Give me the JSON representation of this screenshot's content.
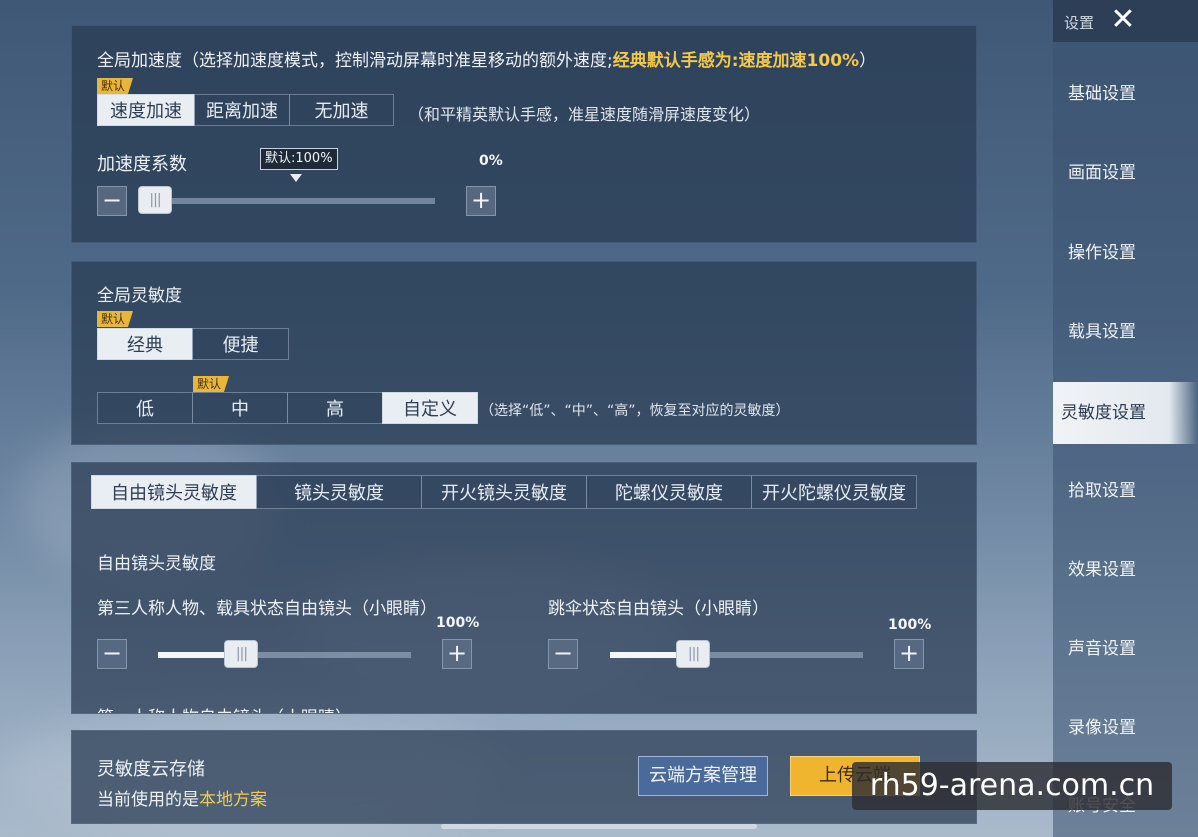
{
  "accel": {
    "title": "全局加速度（选择加速度模式，控制滑动屏幕时准星移动的额外速度;",
    "title_highlight": "经典默认手感为:速度加速100%",
    "title_end": "）",
    "default_badge": "默认",
    "modes": [
      "速度加速",
      "距离加速",
      "无加速"
    ],
    "mode_hint": "（和平精英默认手感，准星速度随滑屏速度变化）",
    "coef_label": "加速度系数",
    "tooltip": "默认:100%",
    "coef_value": "0%",
    "coef_level": 0.0
  },
  "global_sens": {
    "title": "全局灵敏度",
    "default_badge": "默认",
    "styles": [
      "经典",
      "便捷"
    ],
    "level_badge": "默认",
    "levels": [
      "低",
      "中",
      "高",
      "自定义"
    ],
    "level_hint": "（选择“低”、“中”、“高”，恢复至对应的灵敏度）"
  },
  "sens_tabs": [
    "自由镜头灵敏度",
    "镜头灵敏度",
    "开火镜头灵敏度",
    "陀螺仪灵敏度",
    "开火陀螺仪灵敏度"
  ],
  "free_cam": {
    "section_title": "自由镜头灵敏度",
    "slider1_label": "第三人称人物、载具状态自由镜头（小眼睛）",
    "slider1_value": "100%",
    "slider1_level": 0.33,
    "slider2_label": "跳伞状态自由镜头（小眼睛）",
    "slider2_value": "100%",
    "slider2_level": 0.33,
    "next_label_partial": "第一人称人物自由镜头（小眼睛）"
  },
  "cloud": {
    "title": "灵敏度云存储",
    "current_prefix": "当前使用的是",
    "current_value": "本地方案",
    "manage_button": "云端方案管理",
    "upload_button": "上传云端"
  },
  "sidebar": {
    "title": "设置",
    "items": [
      "基础设置",
      "画面设置",
      "操作设置",
      "载具设置",
      "灵敏度设置",
      "拾取设置",
      "效果设置",
      "声音设置",
      "录像设置",
      "账号安全"
    ],
    "active_index": 4
  },
  "watermark": "rh59-arena.com.cn",
  "colors": {
    "accent_yellow": "#f2c94c",
    "badge": "#e8b63a",
    "upload_button": "#f0b52e",
    "manage_button": "#4a6a9c"
  }
}
